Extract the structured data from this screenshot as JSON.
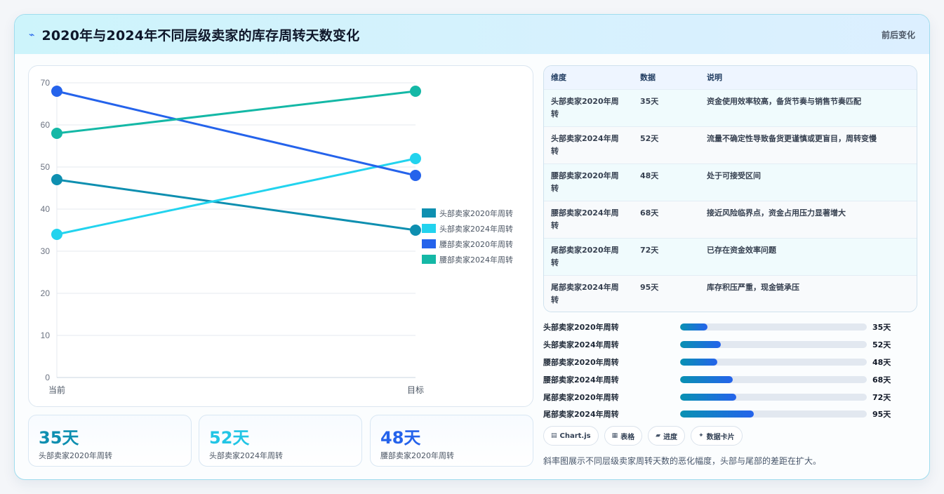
{
  "header": {
    "icon": "chart-line-icon",
    "title": "2020年与2024年不同层级卖家的库存周转天数变化",
    "subtitle": "前后变化"
  },
  "chart_data": {
    "type": "line",
    "categories": [
      "当前",
      "目标"
    ],
    "ylim": [
      0,
      70
    ],
    "yticks": [
      0,
      10,
      20,
      30,
      40,
      50,
      60,
      70
    ],
    "legend_position": "right",
    "series": [
      {
        "name": "头部卖家2020年周转",
        "values": [
          47,
          35
        ],
        "color": "#0e8fb0"
      },
      {
        "name": "头部卖家2024年周转",
        "values": [
          34,
          52
        ],
        "color": "#22d3ee"
      },
      {
        "name": "腰部卖家2020年周转",
        "values": [
          68,
          48
        ],
        "color": "#2563eb"
      },
      {
        "name": "腰部卖家2024年周转",
        "values": [
          58,
          68
        ],
        "color": "#14b8a6"
      }
    ]
  },
  "stats": [
    {
      "value": "35天",
      "label": "头部卖家2020年周转",
      "color": "#0e8fb0"
    },
    {
      "value": "52天",
      "label": "头部卖家2024年周转",
      "color": "#22c5e5"
    },
    {
      "value": "48天",
      "label": "腰部卖家2020年周转",
      "color": "#2563eb"
    }
  ],
  "table": {
    "headers": [
      "维度",
      "数据",
      "说明"
    ],
    "rows": [
      [
        "头部卖家2020年周转",
        "35天",
        "资金使用效率较高，备货节奏与销售节奏匹配"
      ],
      [
        "头部卖家2024年周转",
        "52天",
        "流量不确定性导致备货更谨慎或更盲目，周转变慢"
      ],
      [
        "腰部卖家2020年周转",
        "48天",
        "处于可接受区间"
      ],
      [
        "腰部卖家2024年周转",
        "68天",
        "接近风险临界点，资金占用压力显著增大"
      ],
      [
        "尾部卖家2020年周转",
        "72天",
        "已存在资金效率问题"
      ],
      [
        "尾部卖家2024年周转",
        "95天",
        "库存积压严重，现金链承压"
      ]
    ]
  },
  "progress": {
    "max": 240,
    "items": [
      {
        "label": "头部卖家2020年周转",
        "value": 35,
        "display": "35天"
      },
      {
        "label": "头部卖家2024年周转",
        "value": 52,
        "display": "52天"
      },
      {
        "label": "腰部卖家2020年周转",
        "value": 48,
        "display": "48天"
      },
      {
        "label": "腰部卖家2024年周转",
        "value": 68,
        "display": "68天"
      },
      {
        "label": "尾部卖家2020年周转",
        "value": 72,
        "display": "72天"
      },
      {
        "label": "尾部卖家2024年周转",
        "value": 95,
        "display": "95天"
      }
    ]
  },
  "chips": [
    {
      "icon": "▤",
      "label": "Chart.js"
    },
    {
      "icon": "▦",
      "label": "表格"
    },
    {
      "icon": "▰",
      "label": "进度"
    },
    {
      "icon": "✦",
      "label": "数据卡片"
    }
  ],
  "note": "斜率图展示不同层级卖家周转天数的恶化幅度，头部与尾部的差距在扩大。"
}
